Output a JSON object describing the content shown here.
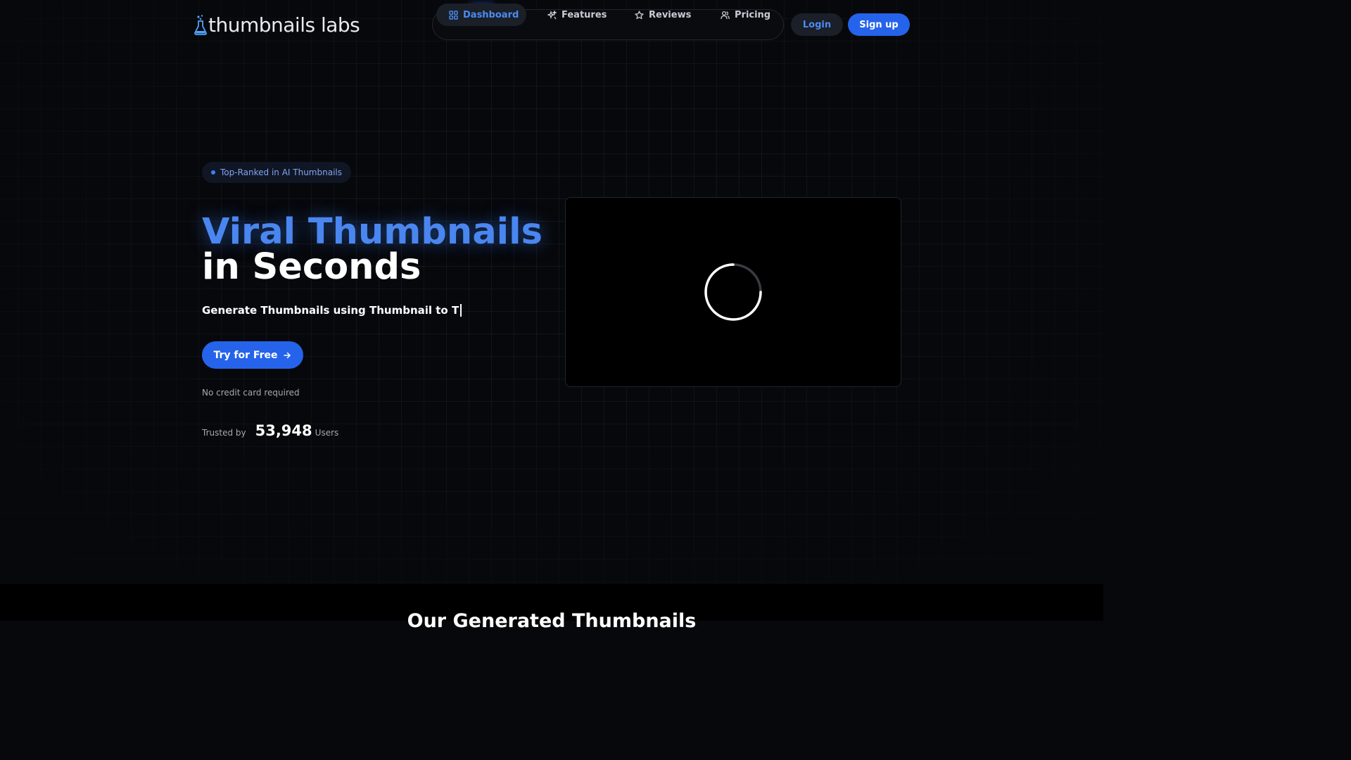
{
  "brand": {
    "name": "thumbnails labs",
    "accent": "#2563eb"
  },
  "nav": {
    "items": [
      {
        "label": "Dashboard",
        "icon": "dashboard-grid-icon",
        "active": true
      },
      {
        "label": "Features",
        "icon": "sparkles-icon",
        "active": false
      },
      {
        "label": "Reviews",
        "icon": "star-icon",
        "active": false
      },
      {
        "label": "Pricing",
        "icon": "users-icon",
        "active": false
      }
    ],
    "login_label": "Login",
    "signup_label": "Sign up"
  },
  "hero": {
    "badge": "Top-Ranked in AI Thumbnails",
    "title_line_1": "Viral Thumbnails",
    "title_line_2": "in Seconds",
    "typed_text": "Generate Thumbnails using Thumbnail to T",
    "cta_label": "Try for Free",
    "cta_icon": "arrow-right-icon",
    "note": "No credit card required",
    "trusted_prefix": "Trusted by",
    "trusted_count": "53,948",
    "trusted_suffix": "Users"
  },
  "preview": {
    "state": "loading",
    "icon": "loading-spinner-icon"
  },
  "gallery": {
    "title": "Our Generated Thumbnails"
  }
}
